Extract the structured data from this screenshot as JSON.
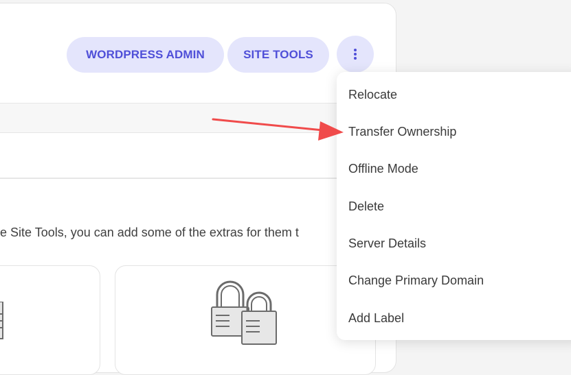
{
  "header": {
    "wordpress_admin_label": "WORDPRESS ADMIN",
    "site_tools_label": "SITE TOOLS"
  },
  "content": {
    "description": "e Site Tools, you can add some of the extras for them t"
  },
  "menu": {
    "items": [
      {
        "label": "Relocate"
      },
      {
        "label": "Transfer Ownership"
      },
      {
        "label": "Offline Mode"
      },
      {
        "label": "Delete"
      },
      {
        "label": "Server Details"
      },
      {
        "label": "Change Primary Domain"
      },
      {
        "label": "Add Label"
      }
    ]
  },
  "colors": {
    "accent": "#4f4fd8",
    "button_background": "#e4e5fc",
    "annotation_arrow": "#f04b4b"
  },
  "icons": {
    "more_options": "vertical-ellipsis-icon",
    "extras_illustration": "padlocks-icon"
  }
}
